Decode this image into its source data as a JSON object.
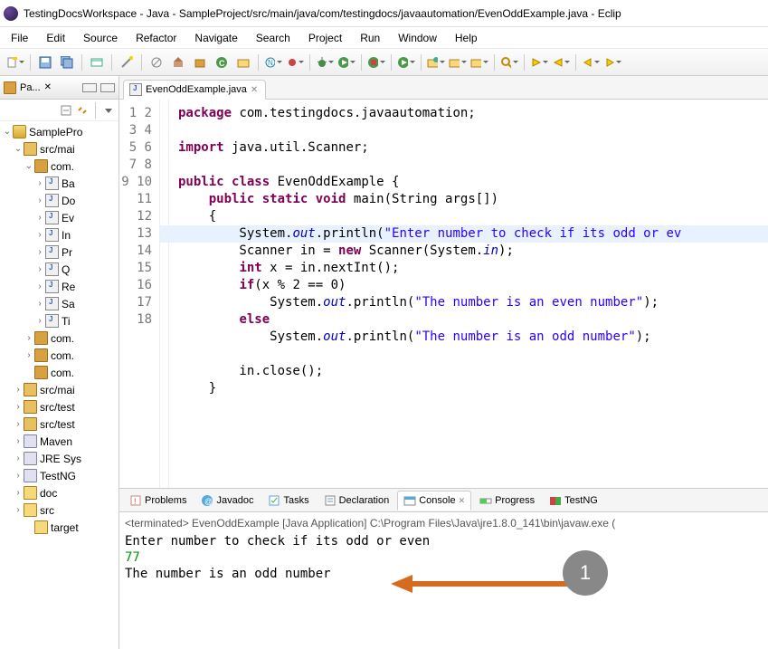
{
  "titlebar": "TestingDocsWorkspace - Java - SampleProject/src/main/java/com/testingdocs/javaautomation/EvenOddExample.java - Eclip",
  "menu": [
    "File",
    "Edit",
    "Source",
    "Refactor",
    "Navigate",
    "Search",
    "Project",
    "Run",
    "Window",
    "Help"
  ],
  "sidebar": {
    "panel_title": "Pa...",
    "nodes": [
      {
        "indent": 0,
        "arrow": "down",
        "ico": "ico-prj",
        "label": "SamplePro"
      },
      {
        "indent": 1,
        "arrow": "down",
        "ico": "ico-src",
        "label": "src/mai"
      },
      {
        "indent": 2,
        "arrow": "down",
        "ico": "ico-pkg",
        "label": "com."
      },
      {
        "indent": 3,
        "arrow": "right",
        "ico": "ico-java",
        "label": "Ba"
      },
      {
        "indent": 3,
        "arrow": "right",
        "ico": "ico-java",
        "label": "Do"
      },
      {
        "indent": 3,
        "arrow": "right",
        "ico": "ico-java",
        "label": "Ev"
      },
      {
        "indent": 3,
        "arrow": "right",
        "ico": "ico-java",
        "label": "In"
      },
      {
        "indent": 3,
        "arrow": "right",
        "ico": "ico-java",
        "label": "Pr"
      },
      {
        "indent": 3,
        "arrow": "right",
        "ico": "ico-java",
        "label": "Q"
      },
      {
        "indent": 3,
        "arrow": "right",
        "ico": "ico-java",
        "label": "Re"
      },
      {
        "indent": 3,
        "arrow": "right",
        "ico": "ico-java",
        "label": "Sa"
      },
      {
        "indent": 3,
        "arrow": "right",
        "ico": "ico-java",
        "label": "Ti"
      },
      {
        "indent": 2,
        "arrow": "right",
        "ico": "ico-pkg",
        "label": "com."
      },
      {
        "indent": 2,
        "arrow": "right",
        "ico": "ico-pkg",
        "label": "com."
      },
      {
        "indent": 2,
        "arrow": "",
        "ico": "ico-pkg",
        "label": "com."
      },
      {
        "indent": 1,
        "arrow": "right",
        "ico": "ico-src",
        "label": "src/mai"
      },
      {
        "indent": 1,
        "arrow": "right",
        "ico": "ico-src",
        "label": "src/test"
      },
      {
        "indent": 1,
        "arrow": "right",
        "ico": "ico-src",
        "label": "src/test"
      },
      {
        "indent": 1,
        "arrow": "right",
        "ico": "ico-lib",
        "label": "Maven"
      },
      {
        "indent": 1,
        "arrow": "right",
        "ico": "ico-lib",
        "label": "JRE Sys"
      },
      {
        "indent": 1,
        "arrow": "right",
        "ico": "ico-lib",
        "label": "TestNG"
      },
      {
        "indent": 1,
        "arrow": "right",
        "ico": "ico-folder",
        "label": "doc"
      },
      {
        "indent": 1,
        "arrow": "right",
        "ico": "ico-folder",
        "label": "src"
      },
      {
        "indent": 2,
        "arrow": "",
        "ico": "ico-folder",
        "label": "target"
      }
    ]
  },
  "editor": {
    "tab_label": "EvenOddExample.java",
    "line_count": 18,
    "code_html": "<span class=\"kw\">package</span> com.testingdocs.javaautomation;\n\n<span class=\"kw\">import</span> java.util.Scanner;\n\n<span class=\"kw\">public</span> <span class=\"kw\">class</span> EvenOddExample {\n    <span class=\"kw\">public</span> <span class=\"kw\">static</span> <span class=\"kw\">void</span> main(String args[])\n    {\n        System.<span class=\"fld\">out</span>.println(<span class=\"str\">\"Enter number to check if its odd or ev</span>\n        Scanner in = <span class=\"kw\">new</span> Scanner(System.<span class=\"fld\">in</span>);\n        <span class=\"kw\">int</span> x = in.nextInt();\n        <span class=\"kw\">if</span>(x % 2 == 0)\n            System.<span class=\"fld\">out</span>.println(<span class=\"str\">\"The number is an even number\"</span>);\n        <span class=\"kw\">else</span>\n            System.<span class=\"fld\">out</span>.println(<span class=\"str\">\"The number is an odd number\"</span>);\n\n        in.close();\n    }\n"
  },
  "bottom": {
    "tabs": [
      {
        "label": "Problems",
        "active": false
      },
      {
        "label": "Javadoc",
        "active": false
      },
      {
        "label": "Tasks",
        "active": false
      },
      {
        "label": "Declaration",
        "active": false
      },
      {
        "label": "Console",
        "active": true
      },
      {
        "label": "Progress",
        "active": false
      },
      {
        "label": "TestNG",
        "active": false
      }
    ],
    "console_header": "<terminated> EvenOddExample [Java Application] C:\\Program Files\\Java\\jre1.8.0_141\\bin\\javaw.exe (",
    "console_lines": [
      {
        "text": "Enter number to check if its odd or even",
        "cls": ""
      },
      {
        "text": "77",
        "cls": "console-input-line"
      },
      {
        "text": "The number is an odd number",
        "cls": ""
      }
    ],
    "annotation_number": "1"
  }
}
